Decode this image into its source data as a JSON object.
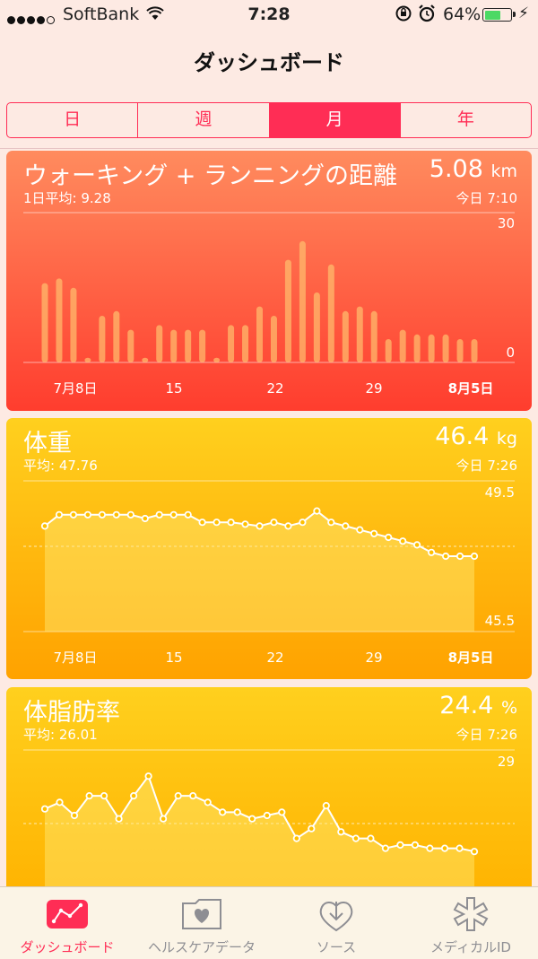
{
  "status": {
    "carrier": "SoftBank",
    "time": "7:28",
    "battery_pct": "64%",
    "battery_level": 0.64
  },
  "nav": {
    "title": "ダッシュボード"
  },
  "segments": [
    {
      "label": "日",
      "active": false
    },
    {
      "label": "週",
      "active": false
    },
    {
      "label": "月",
      "active": true
    },
    {
      "label": "年",
      "active": false
    }
  ],
  "colors": {
    "accent": "#ff2d55",
    "distance_card": "#ff5a3a",
    "weight_card": "#ffb300"
  },
  "cards": {
    "distance": {
      "title": "ウォーキング + ランニングの距離",
      "value": "5.08",
      "unit": "km",
      "avg": "1日平均: 9.28",
      "time": "今日 7:10"
    },
    "weight": {
      "title": "体重",
      "value": "46.4",
      "unit": "kg",
      "avg": "平均: 47.76",
      "time": "今日 7:26"
    },
    "bodyfat": {
      "title": "体脂肪率",
      "value": "24.4",
      "unit": "%",
      "avg": "平均: 26.01",
      "time": "今日 7:26"
    }
  },
  "chart_data": [
    {
      "type": "bar",
      "title": "ウォーキング + ランニングの距離",
      "x_tick_labels": [
        "7月8日",
        "15",
        "22",
        "29",
        "8月5日"
      ],
      "y_tick_labels": [
        "30",
        "0"
      ],
      "ylim": [
        0,
        30
      ],
      "values": [
        17,
        18,
        16,
        1,
        10,
        11,
        7,
        1,
        8,
        7,
        7,
        7,
        1,
        8,
        8,
        12,
        10,
        22,
        26,
        15,
        21,
        11,
        12,
        11,
        5,
        7,
        6,
        6,
        6,
        5,
        5
      ]
    },
    {
      "type": "line",
      "title": "体重",
      "x_tick_labels": [
        "7月8日",
        "15",
        "22",
        "29",
        "8月5日"
      ],
      "y_tick_labels": [
        "49.5",
        "45.5"
      ],
      "ylim": [
        45.5,
        49.5
      ],
      "values": [
        48.3,
        48.6,
        48.6,
        48.6,
        48.6,
        48.6,
        48.6,
        48.5,
        48.6,
        48.6,
        48.6,
        48.4,
        48.4,
        48.4,
        48.35,
        48.3,
        48.4,
        48.3,
        48.4,
        48.7,
        48.4,
        48.3,
        48.2,
        48.1,
        48.0,
        47.9,
        47.8,
        47.6,
        47.5,
        47.5,
        47.5
      ]
    },
    {
      "type": "line",
      "title": "体脂肪率",
      "y_tick_labels": [
        "29"
      ],
      "values": [
        27.2,
        27.4,
        27.0,
        27.6,
        27.6,
        26.9,
        27.6,
        28.2,
        26.9,
        27.6,
        27.6,
        27.4,
        27.1,
        27.1,
        26.9,
        27.0,
        27.1,
        26.3,
        26.6,
        27.3,
        26.5,
        26.3,
        26.3,
        26.0,
        26.1,
        26.1,
        26.0,
        26.0,
        26.0,
        25.9
      ]
    }
  ],
  "tabs": [
    {
      "label": "ダッシュボード",
      "icon": "dashboard-icon",
      "active": true
    },
    {
      "label": "ヘルスケアデータ",
      "icon": "health-data-icon",
      "active": false
    },
    {
      "label": "ソース",
      "icon": "sources-icon",
      "active": false
    },
    {
      "label": "メディカルID",
      "icon": "medical-id-icon",
      "active": false
    }
  ]
}
